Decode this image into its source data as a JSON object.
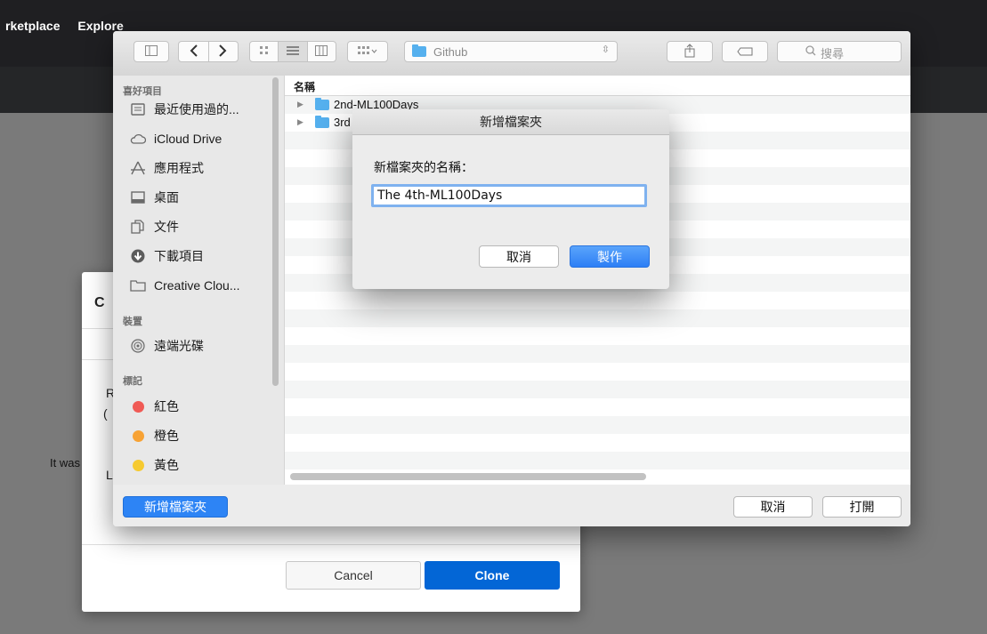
{
  "github": {
    "nav": [
      "rketplace",
      "Explore"
    ],
    "behind_text": "It was",
    "clone_partials": [
      "C",
      "R",
      "(",
      "L"
    ]
  },
  "clone_dialog": {
    "cancel_label": "Cancel",
    "clone_label": "Clone"
  },
  "finder": {
    "toolbar": {
      "path_folder": "Github",
      "search_placeholder": "搜尋"
    },
    "sidebar": {
      "favorites_header": "喜好項目",
      "favorites": [
        {
          "label": "最近使用過的...",
          "icon": "recents-icon"
        },
        {
          "label": "iCloud Drive",
          "icon": "cloud-icon"
        },
        {
          "label": "應用程式",
          "icon": "applications-icon"
        },
        {
          "label": "桌面",
          "icon": "desktop-icon"
        },
        {
          "label": "文件",
          "icon": "documents-icon"
        },
        {
          "label": "下載項目",
          "icon": "downloads-icon"
        },
        {
          "label": "Creative Clou...",
          "icon": "folder-icon"
        }
      ],
      "devices_header": "裝置",
      "devices": [
        {
          "label": "遠端光碟",
          "icon": "disc-icon"
        }
      ],
      "tags_header": "標記",
      "tags": [
        {
          "label": "紅色",
          "color": "#f05a55"
        },
        {
          "label": "橙色",
          "color": "#f7a234"
        },
        {
          "label": "黃色",
          "color": "#f6ca30"
        }
      ]
    },
    "list": {
      "column_name": "名稱",
      "items": [
        "2nd-ML100Days",
        "3rd"
      ]
    },
    "buttons": {
      "new_folder": "新增檔案夾",
      "cancel": "取消",
      "open": "打開"
    }
  },
  "new_folder_sheet": {
    "title": "新增檔案夾",
    "label": "新檔案夾的名稱：",
    "input_value": "The 4th-ML100Days",
    "cancel": "取消",
    "create": "製作"
  }
}
